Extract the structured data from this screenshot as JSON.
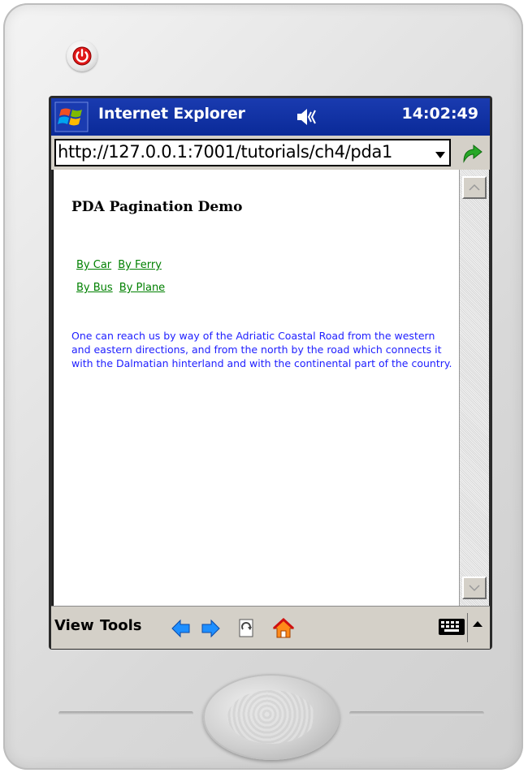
{
  "titlebar": {
    "app_name": "Internet Explorer",
    "time": "14:02:49"
  },
  "address": {
    "url": "http://127.0.0.1:7001/tutorials/ch4/pda1"
  },
  "page": {
    "title": "PDA Pagination Demo",
    "links": [
      [
        "By Car",
        "By Ferry"
      ],
      [
        "By Bus",
        "By Plane"
      ]
    ],
    "body": "One can reach us by way of the Adriatic Coastal Road from the western and eastern directions, and from the north by the road which connects it with the Dalmatian hinterland and with the continental part of the country."
  },
  "menubar": {
    "view_label": "View",
    "tools_label": "Tools"
  },
  "icons": {
    "power": "power-icon",
    "windows": "windows-logo-icon",
    "speaker": "speaker-icon",
    "go": "go-arrow-icon",
    "back": "back-arrow-icon",
    "forward": "forward-arrow-icon",
    "refresh": "refresh-icon",
    "home": "home-icon",
    "keyboard": "keyboard-icon"
  },
  "colors": {
    "titlebar_bg": "#0a2a98",
    "link_color": "#008000",
    "body_text_color": "#2020ff"
  }
}
